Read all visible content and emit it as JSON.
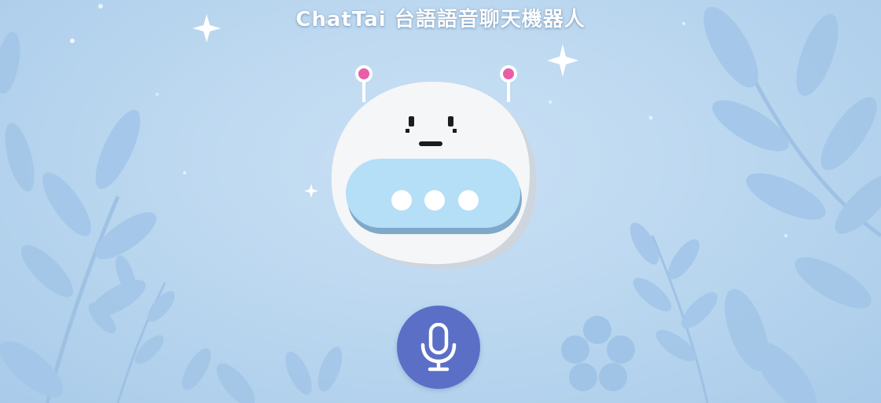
{
  "header": {
    "title": "ChatTai 台語語音聊天機器人"
  },
  "mascot": {
    "icon": "robot-mascot-icon",
    "status_icon": "typing-ellipsis-icon"
  },
  "controls": {
    "mic_icon": "microphone-icon",
    "accent_color": "#5b6fc6"
  },
  "theme": {
    "background_color": "#bcd8f0",
    "antenna_tip_color": "#e85ea8",
    "bubble_color": "#b5def7"
  }
}
